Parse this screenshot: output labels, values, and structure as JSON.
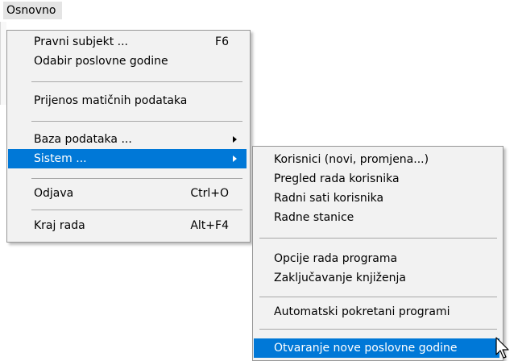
{
  "menubar": {
    "title": "Osnovno"
  },
  "main_menu": {
    "items": [
      {
        "label": "Pravni subjekt ...",
        "shortcut": "F6"
      },
      {
        "label": "Odabir poslovne godine"
      },
      {
        "label": "Prijenos matičnih podataka"
      },
      {
        "label": "Baza podataka ..."
      },
      {
        "label": "Sistem ..."
      },
      {
        "label": "Odjava",
        "shortcut": "Ctrl+O"
      },
      {
        "label": "Kraj rada",
        "shortcut": "Alt+F4"
      }
    ],
    "highlighted": "Sistem ..."
  },
  "submenu": {
    "items": [
      {
        "label": "Korisnici (novi, promjena...)"
      },
      {
        "label": "Pregled rada korisnika"
      },
      {
        "label": "Radni sati korisnika"
      },
      {
        "label": "Radne stanice"
      },
      {
        "label": "Opcije rada programa"
      },
      {
        "label": "Zaključavanje knjiženja"
      },
      {
        "label": "Automatski pokretani programi"
      },
      {
        "label": "Otvaranje nove poslovne godine"
      }
    ],
    "highlighted": "Otvaranje nove poslovne godine"
  },
  "colors": {
    "highlight": "#0078d7",
    "menu_bg": "#f2f2f2",
    "menubar_active": "#e4e4e4"
  },
  "icons": {
    "submenu_arrow": "triangle-right-icon",
    "cursor": "mouse-pointer-icon"
  }
}
